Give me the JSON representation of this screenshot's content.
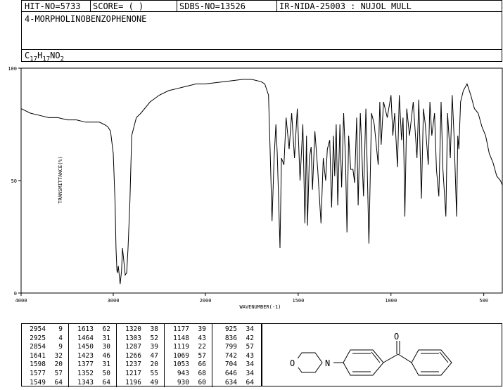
{
  "header": {
    "hit_no": "HIT-NO=5733",
    "score": "SCORE=  (   )",
    "sdbs_no": "SDBS-NO=13526",
    "ir_nida": "IR-NIDA-25003 : NUJOL MULL"
  },
  "compound_name": "4-MORPHOLINOBENZOPHENONE",
  "formula": {
    "C": "C",
    "c_sub": "17",
    "H": "H",
    "h_sub": "17",
    "rest": "NO",
    "o_sub": "2"
  },
  "chart_data": {
    "type": "line",
    "xlabel": "WAVENUMBER(-1)",
    "ylabel": "TRANSMITTANCE(%)",
    "xlim": [
      4000,
      400
    ],
    "ylim": [
      0,
      100
    ],
    "x_ticks": [
      "4000",
      "3000",
      "2000",
      "1500",
      "1000",
      "500"
    ],
    "y_ticks": [
      "100",
      "50",
      "0"
    ],
    "series": [
      {
        "x": [
          4000,
          3900,
          3800,
          3700,
          3600,
          3500,
          3400,
          3300,
          3200,
          3150,
          3100,
          3060,
          3030,
          3000,
          2980,
          2970,
          2960,
          2954,
          2945,
          2935,
          2925,
          2910,
          2900,
          2885,
          2870,
          2854,
          2840,
          2820,
          2800,
          2750,
          2700,
          2600,
          2500,
          2400,
          2300,
          2200,
          2100,
          2000,
          1900,
          1800,
          1750,
          1700,
          1680,
          1660,
          1650,
          1641,
          1630,
          1620,
          1613,
          1605,
          1598,
          1590,
          1577,
          1565,
          1549,
          1535,
          1520,
          1505,
          1490,
          1475,
          1464,
          1455,
          1450,
          1440,
          1430,
          1423,
          1410,
          1395,
          1377,
          1365,
          1352,
          1343,
          1330,
          1320,
          1310,
          1303,
          1295,
          1287,
          1275,
          1266,
          1255,
          1245,
          1237,
          1228,
          1217,
          1205,
          1196,
          1185,
          1177,
          1165,
          1148,
          1135,
          1119,
          1105,
          1090,
          1069,
          1060,
          1053,
          1040,
          1020,
          1000,
          990,
          980,
          965,
          955,
          943,
          935,
          930,
          925,
          915,
          900,
          880,
          860,
          850,
          836,
          825,
          815,
          799,
          790,
          780,
          765,
          755,
          742,
          730,
          720,
          704,
          695,
          680,
          670,
          660,
          646,
          640,
          634,
          625,
          610,
          590,
          570,
          550,
          530,
          510,
          490,
          470,
          450,
          430,
          410,
          400
        ],
        "y": [
          82,
          80,
          79,
          78,
          78,
          77,
          77,
          76,
          76,
          76,
          75,
          74,
          72,
          62,
          40,
          20,
          10,
          9,
          12,
          8,
          4,
          10,
          20,
          14,
          8,
          9,
          20,
          40,
          70,
          78,
          80,
          85,
          88,
          90,
          91,
          92,
          93,
          93,
          94,
          95,
          95,
          94,
          93,
          88,
          60,
          32,
          60,
          75,
          62,
          40,
          20,
          60,
          57,
          78,
          64,
          80,
          60,
          82,
          50,
          75,
          31,
          70,
          30,
          60,
          65,
          46,
          72,
          55,
          31,
          60,
          50,
          64,
          68,
          38,
          70,
          52,
          75,
          39,
          75,
          47,
          80,
          60,
          27,
          70,
          55,
          55,
          49,
          78,
          39,
          80,
          43,
          82,
          22,
          80,
          75,
          57,
          85,
          66,
          85,
          78,
          88,
          70,
          80,
          56,
          88,
          68,
          78,
          60,
          34,
          82,
          70,
          85,
          60,
          86,
          42,
          82,
          75,
          57,
          85,
          70,
          80,
          55,
          43,
          85,
          55,
          34,
          80,
          60,
          88,
          70,
          34,
          70,
          64,
          85,
          90,
          93,
          88,
          82,
          80,
          74,
          70,
          62,
          58,
          52,
          50,
          48
        ]
      }
    ]
  },
  "peaks": [
    [
      [
        "2954",
        "9"
      ],
      [
        "2925",
        "4"
      ],
      [
        "2854",
        "9"
      ],
      [
        "1641",
        "32"
      ],
      [
        "1598",
        "20"
      ],
      [
        "1577",
        "57"
      ],
      [
        "1549",
        "64"
      ]
    ],
    [
      [
        "1613",
        "62"
      ],
      [
        "1464",
        "31"
      ],
      [
        "1450",
        "30"
      ],
      [
        "1423",
        "46"
      ],
      [
        "1377",
        "31"
      ],
      [
        "1352",
        "50"
      ],
      [
        "1343",
        "64"
      ]
    ],
    [
      [
        "1320",
        "38"
      ],
      [
        "1303",
        "52"
      ],
      [
        "1287",
        "39"
      ],
      [
        "1266",
        "47"
      ],
      [
        "1237",
        "20"
      ],
      [
        "1217",
        "55"
      ],
      [
        "1196",
        "49"
      ]
    ],
    [
      [
        "1177",
        "39"
      ],
      [
        "1148",
        "43"
      ],
      [
        "1119",
        "22"
      ],
      [
        "1069",
        "57"
      ],
      [
        "1053",
        "66"
      ],
      [
        "943",
        "68"
      ],
      [
        "930",
        "60"
      ]
    ],
    [
      [
        "925",
        "34"
      ],
      [
        "836",
        "42"
      ],
      [
        "799",
        "57"
      ],
      [
        "742",
        "43"
      ],
      [
        "704",
        "34"
      ],
      [
        "646",
        "34"
      ],
      [
        "634",
        "64"
      ]
    ]
  ],
  "structure": {
    "oxygen_ring": "O",
    "nitrogen": "N",
    "carbonyl_o": "O"
  }
}
